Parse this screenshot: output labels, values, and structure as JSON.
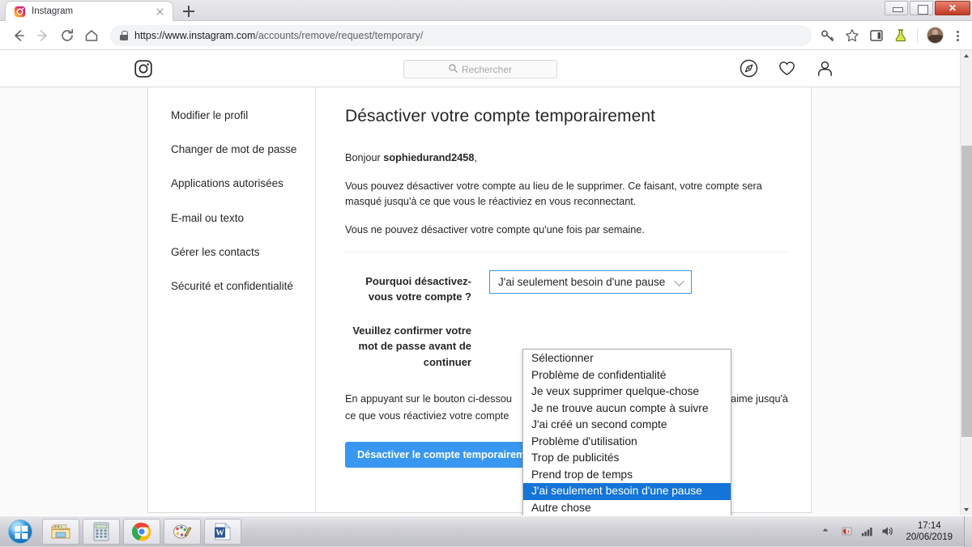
{
  "browser": {
    "tab": {
      "title": "Instagram",
      "favicon_icon": "instagram-favicon",
      "close_icon": "close-icon"
    },
    "new_tab_icon": "plus-icon",
    "window_controls": {
      "minimize": "minimize-icon",
      "maximize": "maximize-icon",
      "close": "✕"
    },
    "nav": {
      "back_icon": "back-arrow-icon",
      "forward_icon": "forward-arrow-icon",
      "reload_icon": "reload-icon",
      "home_icon": "home-icon"
    },
    "omnibox": {
      "lock_icon": "lock-icon",
      "url_scheme_host": "https://www.instagram.com",
      "url_path": "/accounts/remove/request/temporary/"
    },
    "toolbar_icons": [
      "key-icon",
      "star-bookmark-icon",
      "side-panel-icon",
      "flask-experiments-icon",
      "avatar",
      "three-dot-menu-icon"
    ]
  },
  "instagram_header": {
    "logo_icon": "instagram-camera-logo",
    "search": {
      "placeholder": "Rechercher",
      "icon": "search-icon"
    },
    "nav_icons": [
      "explore-compass-icon",
      "activity-heart-icon",
      "profile-person-icon"
    ]
  },
  "sidebar": {
    "items": [
      {
        "label": "Modifier le profil"
      },
      {
        "label": "Changer de mot de passe"
      },
      {
        "label": "Applications autorisées"
      },
      {
        "label": "E-mail ou texto"
      },
      {
        "label": "Gérer les contacts"
      },
      {
        "label": "Sécurité et confidentialité"
      }
    ]
  },
  "main": {
    "title": "Désactiver votre compte temporairement",
    "greeting_prefix": "Bonjour ",
    "username": "sophiedurand2458",
    "greeting_suffix": ",",
    "paragraph1": "Vous pouvez désactiver votre compte au lieu de le supprimer. Ce faisant, votre compte sera masqué jusqu'à ce que vous le réactiviez en vous reconnectant.",
    "paragraph2": "Vous ne pouvez désactiver votre compte qu'une fois par semaine.",
    "reason_label": "Pourquoi désactivez-vous votre compte ?",
    "password_label": "Veuillez confirmer votre mot de passe avant de continuer",
    "select": {
      "value": "J'ai seulement besoin d'une pause",
      "chevron_icon": "chevron-down-icon",
      "options": [
        "Sélectionner",
        "Problème de confidentialité",
        "Je veux supprimer quelque-chose",
        "Je ne trouve aucun compte à suivre",
        "J'ai créé un second compte",
        "Problème d'utilisation",
        "Trop de publicités",
        "Prend trop de temps",
        "J'ai seulement besoin d'une pause",
        "Autre chose"
      ],
      "selected_index": 8
    },
    "bottom_note_left": "En appuyant sur le bouton ci-dessou",
    "bottom_note_right": "'aime jusqu'à",
    "bottom_note_line2": "ce que vous réactiviez votre compte",
    "deactivate_button": "Désactiver le compte temporairement"
  },
  "colors": {
    "instagram_blue": "#3897f0",
    "select_highlight": "#1474d8",
    "border_grey": "#dbdbdb",
    "text": "#262626"
  },
  "taskbar": {
    "start_icon": "windows-start-orb",
    "buttons": [
      "file-explorer-icon",
      "calculator-icon",
      "chrome-icon",
      "paint-icon",
      "word-icon"
    ],
    "tray_icons": [
      "show-hidden-arrow-icon",
      "antivirus-icon",
      "network-signal-icon",
      "volume-icon"
    ],
    "clock_time": "17:14",
    "clock_date": "20/06/2019"
  }
}
